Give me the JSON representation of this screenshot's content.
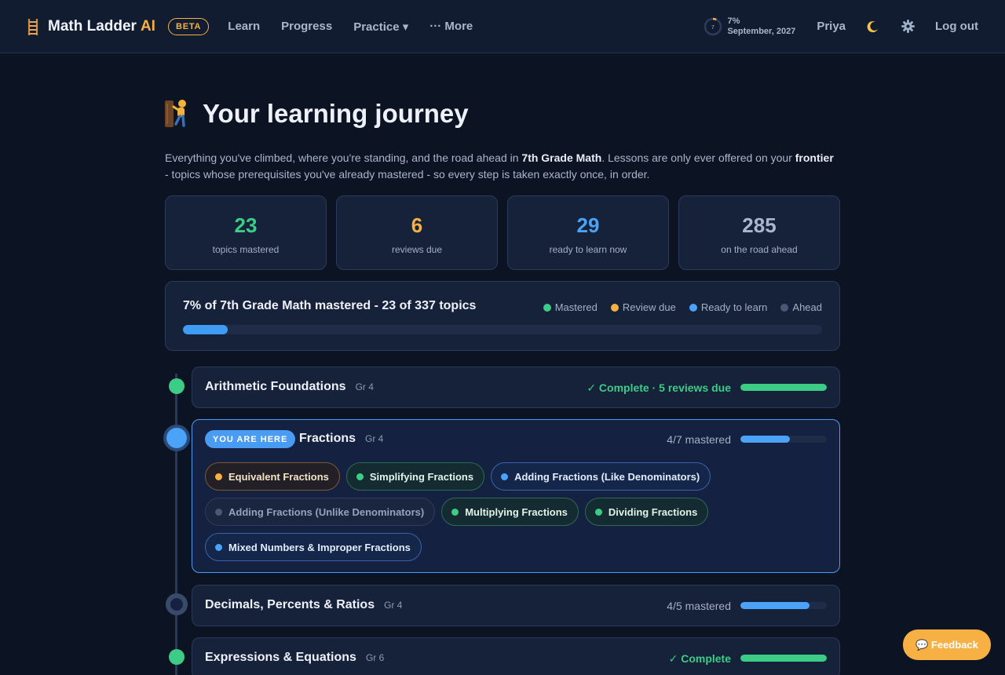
{
  "header": {
    "brand_name": "Math Ladder",
    "brand_ai": "AI",
    "beta": "BETA",
    "nav": [
      "Learn",
      "Progress",
      "Practice ▾",
      "··· More"
    ],
    "goal_ring_number": "7",
    "goal_percent": "7%",
    "goal_date": "September, 2027",
    "goal_progress": 0.07,
    "user_name": "Priya",
    "theme_icon": "moon-icon",
    "settings_icon": "gear-icon",
    "logout": "Log out"
  },
  "page": {
    "title": "Your learning journey",
    "intro_1": "Everything you've climbed, where you're standing, and the road ahead in ",
    "intro_course": "7th Grade Math",
    "intro_2": ". Lessons are only ever offered on your ",
    "intro_frontier": "frontier",
    "intro_3": " - topics whose prerequisites you've already mastered - so every step is taken exactly once, in order."
  },
  "stats": [
    {
      "value": "23",
      "label": "topics mastered",
      "color": "#3dcc85"
    },
    {
      "value": "6",
      "label": "reviews due",
      "color": "#f6b043"
    },
    {
      "value": "29",
      "label": "ready to learn now",
      "color": "#4aa3f7"
    },
    {
      "value": "285",
      "label": "on the road ahead",
      "color": "#aab6cc"
    }
  ],
  "overall": {
    "title": "7% of 7th Grade Math mastered - 23 of 337 topics",
    "progress": 0.07,
    "legend": [
      {
        "label": "Mastered",
        "color": "#3dcc85"
      },
      {
        "label": "Review due",
        "color": "#f6b043"
      },
      {
        "label": "Ready to learn",
        "color": "#4aa3f7"
      },
      {
        "label": "Ahead",
        "color": "#4a5875"
      }
    ]
  },
  "units": [
    {
      "name": "Arithmetic Foundations",
      "grade": "Gr 4",
      "status": "✓ Complete · 5 reviews due",
      "status_color": "#3dcc85",
      "progress": 1.0,
      "bar_color": "#3dcc85"
    },
    {
      "name": "Fractions",
      "grade": "Gr 4",
      "badge": "YOU ARE HERE",
      "status": "4/7 mastered",
      "status_color": "#a4b0c6",
      "progress": 0.57,
      "bar_color": "#4aa3f7",
      "topics": [
        {
          "label": "Equivalent Fractions",
          "state": "review"
        },
        {
          "label": "Simplifying Fractions",
          "state": "mastered"
        },
        {
          "label": "Adding Fractions (Like Denominators)",
          "state": "ready"
        },
        {
          "label": "Adding Fractions (Unlike Denominators)",
          "state": "ahead"
        },
        {
          "label": "Multiplying Fractions",
          "state": "mastered"
        },
        {
          "label": "Dividing Fractions",
          "state": "mastered"
        },
        {
          "label": "Mixed Numbers & Improper Fractions",
          "state": "ready"
        }
      ]
    },
    {
      "name": "Decimals, Percents & Ratios",
      "grade": "Gr 4",
      "status": "4/5 mastered",
      "status_color": "#a4b0c6",
      "progress": 0.8,
      "bar_color": "#4aa3f7"
    },
    {
      "name": "Expressions & Equations",
      "grade": "Gr 6",
      "status": "✓ Complete",
      "status_color": "#3dcc85",
      "progress": 1.0,
      "bar_color": "#3dcc85"
    }
  ],
  "feedback": "💬 Feedback"
}
